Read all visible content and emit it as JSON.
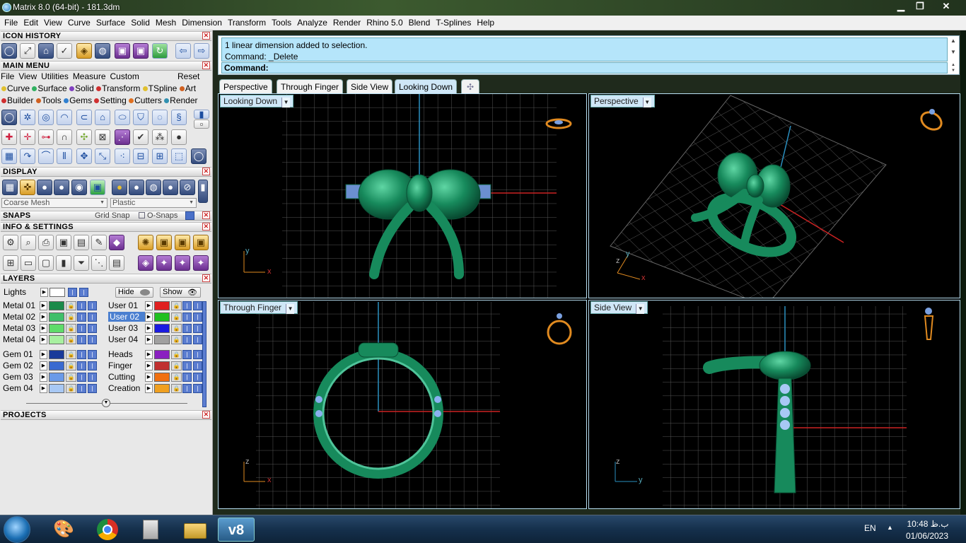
{
  "window": {
    "title": "Matrix 8.0 (64-bit) - 181.3dm",
    "min": "▁",
    "max": "❐",
    "close": "✕"
  },
  "menubar": [
    "File",
    "Edit",
    "View",
    "Curve",
    "Surface",
    "Solid",
    "Mesh",
    "Dimension",
    "Transform",
    "Tools",
    "Analyze",
    "Render",
    "Rhino 5.0",
    "Blend",
    "T-Splines",
    "Help"
  ],
  "panels": {
    "icon_history": "ICON HISTORY",
    "main_menu": "MAIN MENU",
    "display": "DISPLAY",
    "snaps": "SNAPS",
    "info_settings": "INFO & SETTINGS",
    "layers": "LAYERS",
    "projects": "PROJECTS"
  },
  "main_menu_row": {
    "items": [
      "File",
      "View",
      "Utilities",
      "Measure",
      "Custom"
    ],
    "reset": "Reset"
  },
  "main_menu_cats1": [
    {
      "label": "Curve",
      "color": "#e0c030"
    },
    {
      "label": "Surface",
      "color": "#30b060"
    },
    {
      "label": "Solid",
      "color": "#8040c0"
    },
    {
      "label": "Transform",
      "color": "#d03030"
    },
    {
      "label": "TSpline",
      "color": "#e0c030"
    },
    {
      "label": "Art",
      "color": "#d06020"
    }
  ],
  "main_menu_cats2": [
    {
      "label": "Builder",
      "color": "#d03030"
    },
    {
      "label": "Tools",
      "color": "#d06020"
    },
    {
      "label": "Gems",
      "color": "#3080d0"
    },
    {
      "label": "Setting",
      "color": "#d03030"
    },
    {
      "label": "Cutters",
      "color": "#e07020"
    },
    {
      "label": "Render",
      "color": "#3090b0"
    }
  ],
  "display": {
    "mesh": "Coarse Mesh",
    "material": "Plastic"
  },
  "snaps": {
    "grid_snap": "Grid Snap",
    "o_snaps": "O-Snaps"
  },
  "layers_header": {
    "lights": "Lights",
    "hide": "Hide",
    "show": "Show"
  },
  "layers_left": [
    {
      "name": "Metal 01",
      "color": "#1a8a4a"
    },
    {
      "name": "Metal 02",
      "color": "#3fbf6a"
    },
    {
      "name": "Metal 03",
      "color": "#5fdc6a"
    },
    {
      "name": "Metal 04",
      "color": "#a8f0a0"
    },
    {
      "name": "Gem 01",
      "color": "#1a3a9a"
    },
    {
      "name": "Gem 02",
      "color": "#3a6ad0"
    },
    {
      "name": "Gem 03",
      "color": "#6a9ae8"
    },
    {
      "name": "Gem 04",
      "color": "#a8c8f4"
    }
  ],
  "layers_right": [
    {
      "name": "User 01",
      "color": "#e02020"
    },
    {
      "name": "User 02",
      "color": "#20c020"
    },
    {
      "name": "User 03",
      "color": "#1a1ae0"
    },
    {
      "name": "User 04",
      "color": "#a0a0a0"
    },
    {
      "name": "Heads",
      "color": "#8a20c0"
    },
    {
      "name": "Finger",
      "color": "#c03030"
    },
    {
      "name": "Cutting",
      "color": "#f07010"
    },
    {
      "name": "Creation",
      "color": "#f0a020"
    }
  ],
  "command": {
    "history": [
      "1 linear dimension added to selection.",
      "Command: _Delete"
    ],
    "prompt": "Command:"
  },
  "tabs": [
    "Perspective",
    "Through Finger",
    "Side View",
    "Looking Down"
  ],
  "tab_add": "✣",
  "active_tab": "Looking Down",
  "viewports": {
    "top_left": "Looking Down",
    "top_right": "Perspective",
    "bottom_left": "Through Finger",
    "bottom_right": "Side View"
  },
  "axes": {
    "y": "y",
    "x": "x",
    "z": "z"
  },
  "taskbar": {
    "lang": "EN",
    "time": "10:48 ب.ظ",
    "date": "01/06/2023"
  },
  "colors": {
    "model": "#1f8a5e",
    "grid": "#5a5a5a",
    "axis_red": "#c22",
    "axis_blue": "#2a8fbf",
    "accent": "#b5e5fa"
  }
}
